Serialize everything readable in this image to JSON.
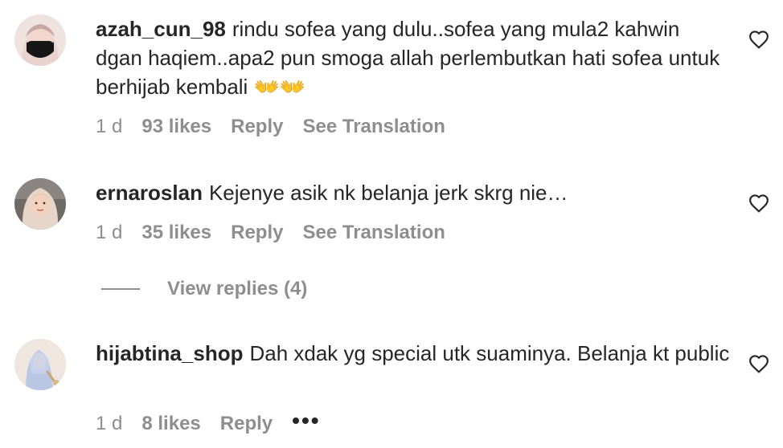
{
  "comments": [
    {
      "username": "azah_cun_98",
      "text": "rindu sofea yang dulu..sofea yang mula2 kahwin dgan haqiem..apa2 pun smoga allah perlembutkan hati sofea untuk berhijab kembali 👐👐",
      "time": "1 d",
      "likes": "93 likes",
      "reply_label": "Reply",
      "translate_label": "See Translation"
    },
    {
      "username": "ernaroslan",
      "text": "Kejenye asik nk belanja jerk skrg nie…",
      "time": "1 d",
      "likes": "35 likes",
      "reply_label": "Reply",
      "translate_label": "See Translation",
      "view_replies": "View replies (4)"
    },
    {
      "username": "hijabtina_shop",
      "text": "Dah xdak yg special utk suaminya. Belanja kt public",
      "time": "1 d",
      "likes": "8 likes",
      "reply_label": "Reply",
      "more_label": "•••"
    }
  ],
  "icons": {
    "like": "heart-outline-icon",
    "more": "more-options-icon"
  }
}
